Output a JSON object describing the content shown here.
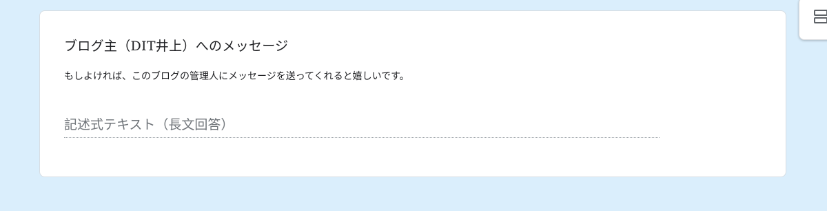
{
  "question": {
    "title": "ブログ主（DIT井上）へのメッセージ",
    "description": "もしよければ、このブログの管理人にメッセージを送ってくれると嬉しいです。",
    "answer_placeholder": "記述式テキスト（長文回答）",
    "answer_value": ""
  },
  "toolbar": {
    "icon": "add-section-icon"
  },
  "colors": {
    "background": "#daeefc",
    "card": "#ffffff",
    "text": "#202124",
    "placeholder": "#70757a"
  }
}
